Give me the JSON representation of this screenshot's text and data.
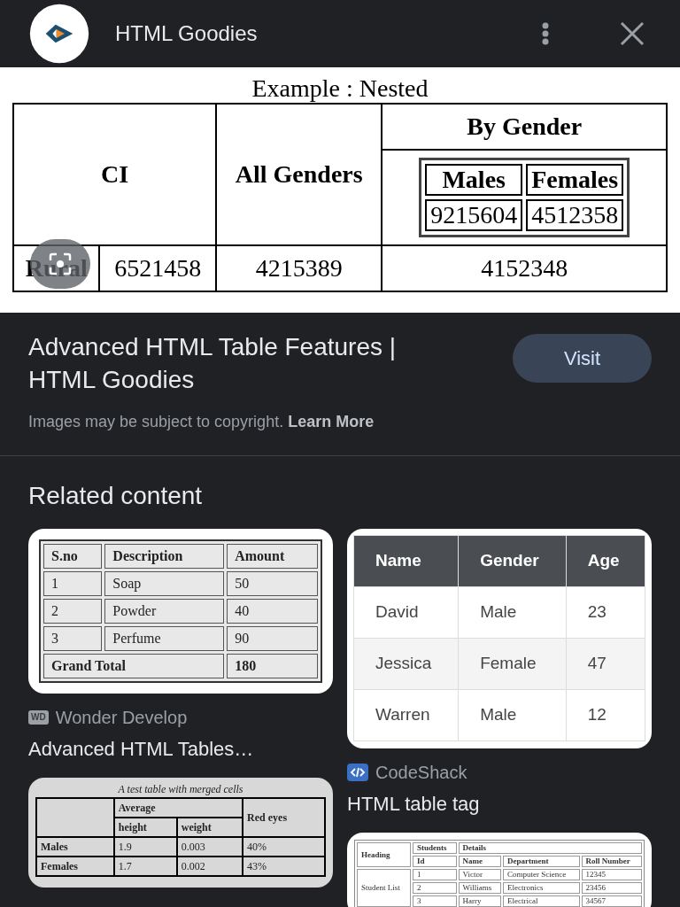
{
  "header": {
    "site": "HTML Goodies"
  },
  "main_image": {
    "caption": "Example : Nested",
    "table": {
      "rows": [
        [
          {
            "text": "CI",
            "header": true,
            "rowspan": 2,
            "colspan": 2
          },
          {
            "text": "All Genders",
            "header": true,
            "rowspan": 2
          },
          {
            "text": "By Gender",
            "header": true
          }
        ],
        [
          {
            "table": {
              "rows": [
                [
                  {
                    "text": "Males",
                    "header": true
                  },
                  {
                    "text": "Females",
                    "header": true
                  }
                ],
                [
                  {
                    "text": "9215604"
                  },
                  {
                    "text": "4512358"
                  }
                ]
              ]
            }
          }
        ],
        [
          {
            "text": "Rural",
            "header": true
          },
          {
            "text": "6521458"
          },
          {
            "text": "4215389"
          },
          {
            "text": "4152348"
          }
        ]
      ]
    }
  },
  "result": {
    "title": "Advanced HTML Table Features | HTML Goodies",
    "button": "Visit",
    "notice": "Images may be subject to copyright.",
    "notice_link": "Learn More"
  },
  "related": {
    "heading": "Related content",
    "columns": [
      [
        {
          "kind": "classic",
          "source": "Wonder Develop",
          "source_icon": "WD",
          "title": "Advanced HTML Tables…",
          "table": {
            "rows": [
              [
                {
                  "text": "S.no",
                  "header": true
                },
                {
                  "text": "Description",
                  "header": true
                },
                {
                  "text": "Amount",
                  "header": true
                }
              ],
              [
                {
                  "text": "1"
                },
                {
                  "text": "Soap"
                },
                {
                  "text": "50"
                }
              ],
              [
                {
                  "text": "2"
                },
                {
                  "text": "Powder"
                },
                {
                  "text": "40"
                }
              ],
              [
                {
                  "text": "3"
                },
                {
                  "text": "Perfume"
                },
                {
                  "text": "90"
                }
              ],
              [
                {
                  "text": "Grand Total",
                  "header": true,
                  "colspan": 2
                },
                {
                  "text": "180",
                  "header": true
                }
              ]
            ]
          }
        },
        {
          "kind": "gray",
          "caption": "A test table with merged cells",
          "table": {
            "rows": [
              [
                {
                  "header": true,
                  "rowspan": 2
                },
                {
                  "text": "Average",
                  "header": true,
                  "colspan": 2
                },
                {
                  "text": "Red eyes",
                  "header": true,
                  "rowspan": 2
                }
              ],
              [
                {
                  "text": "height",
                  "header": true
                },
                {
                  "text": "weight",
                  "header": true
                }
              ],
              [
                {
                  "text": "Males",
                  "header": true
                },
                {
                  "text": "1.9"
                },
                {
                  "text": "0.003"
                },
                {
                  "text": "40%"
                }
              ],
              [
                {
                  "text": "Females",
                  "header": true
                },
                {
                  "text": "1.7"
                },
                {
                  "text": "0.002"
                },
                {
                  "text": "43%"
                }
              ]
            ]
          }
        }
      ],
      [
        {
          "kind": "modern",
          "source": "CodeShack",
          "title": "HTML table tag",
          "table": {
            "rows": [
              [
                {
                  "text": "Name",
                  "header": true
                },
                {
                  "text": "Gender",
                  "header": true
                },
                {
                  "text": "Age",
                  "header": true
                }
              ],
              [
                {
                  "text": "David"
                },
                {
                  "text": "Male"
                },
                {
                  "text": "23"
                }
              ],
              [
                {
                  "text": "Jessica"
                },
                {
                  "text": "Female"
                },
                {
                  "text": "47"
                }
              ],
              [
                {
                  "text": "Warren"
                },
                {
                  "text": "Male"
                },
                {
                  "text": "12"
                }
              ]
            ]
          }
        },
        {
          "kind": "small",
          "table": {
            "rows": [
              [
                {
                  "text": "Heading",
                  "header": true,
                  "rowspan": 2
                },
                {
                  "text": "Students",
                  "header": true
                },
                {
                  "text": "Details",
                  "header": true,
                  "colspan": 3
                }
              ],
              [
                {
                  "text": "Id",
                  "header": true
                },
                {
                  "text": "Name",
                  "header": true
                },
                {
                  "text": "Department",
                  "header": true
                },
                {
                  "text": "Roll Number",
                  "header": true
                }
              ],
              [
                {
                  "text": "Student List",
                  "rowspan": 3
                },
                {
                  "text": "1"
                },
                {
                  "text": "Victor"
                },
                {
                  "text": "Computer Science"
                },
                {
                  "text": "12345"
                }
              ],
              [
                {
                  "text": "2"
                },
                {
                  "text": "Williams"
                },
                {
                  "text": "Electronics"
                },
                {
                  "text": "23456"
                }
              ],
              [
                {
                  "text": "3"
                },
                {
                  "text": "Harry"
                },
                {
                  "text": "Electrical"
                },
                {
                  "text": "34567"
                }
              ]
            ]
          }
        }
      ]
    ]
  }
}
